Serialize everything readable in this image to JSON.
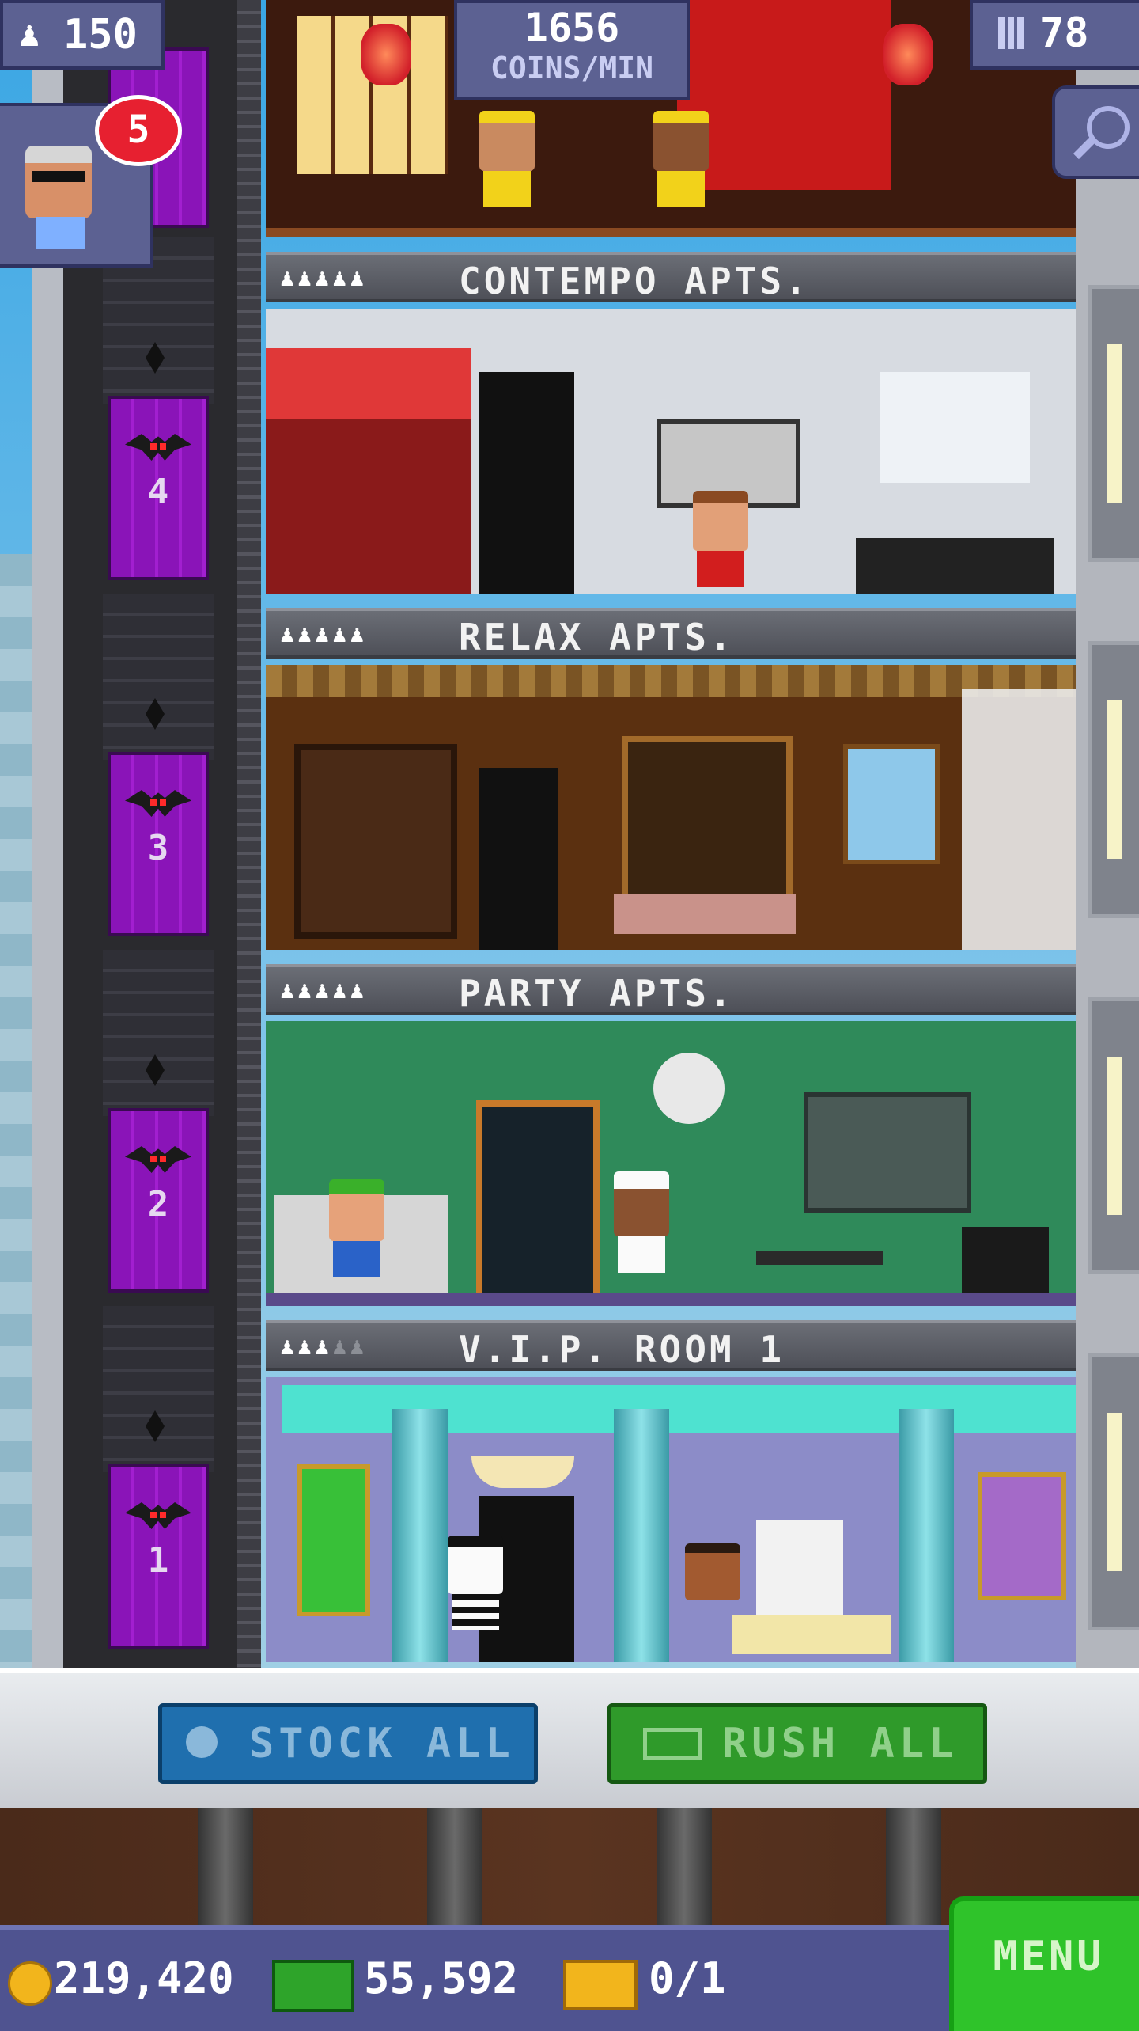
{
  "hud": {
    "population": "150",
    "coins_per_min": "1656",
    "coins_per_min_unit": "COINS/MIN",
    "floor_count": "78",
    "visitor_badge": "5"
  },
  "floors": [
    {
      "name": "CONTEMPO APTS.",
      "stars": 5,
      "stars_filled": 5
    },
    {
      "name": "RELAX APTS.",
      "stars": 5,
      "stars_filled": 5
    },
    {
      "name": "PARTY APTS.",
      "stars": 5,
      "stars_filled": 5
    },
    {
      "name": "V.I.P. ROOM 1",
      "stars": 5,
      "stars_filled": 3
    }
  ],
  "elevator": {
    "floor_numbers": [
      "4",
      "3",
      "2",
      "1"
    ],
    "car_color": "#9b1bc8"
  },
  "actions": {
    "stock_all": "STOCK ALL",
    "rush_all": "RUSH ALL"
  },
  "currency": {
    "coins": "219,420",
    "bux": "55,592",
    "tickets": "0/1"
  },
  "menu_label": "MENU",
  "colors": {
    "hud_bg": "#5c6192",
    "stock_btn": "#1f6fae",
    "rush_btn": "#2f9a2a",
    "menu_btn": "#2fc32a",
    "badge": "#e72030"
  }
}
